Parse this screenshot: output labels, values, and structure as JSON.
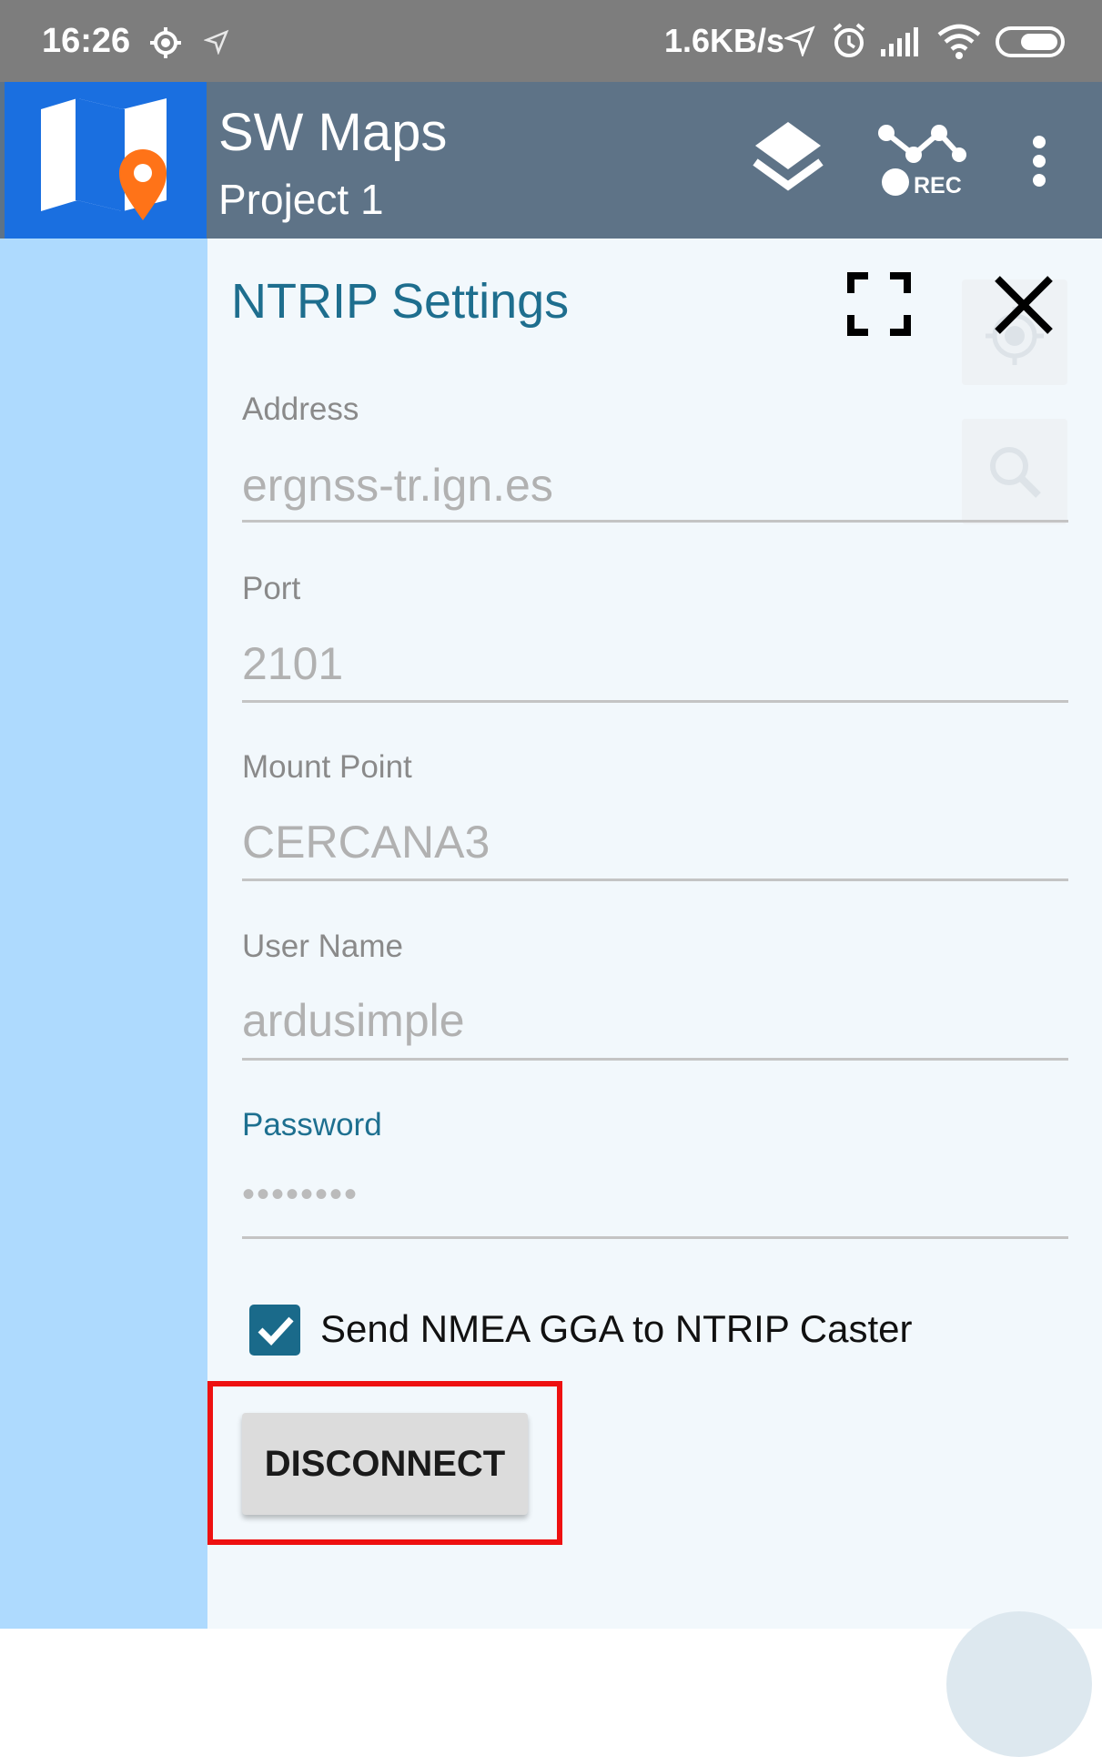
{
  "status_bar": {
    "time": "16:26",
    "network_speed": "1.6KB/s",
    "icons": [
      "location-target-icon",
      "navigation-arrow-icon",
      "navigation-arrow-icon",
      "alarm-icon",
      "cell-signal-icon",
      "wifi-icon",
      "battery-icon"
    ]
  },
  "toolbar": {
    "app_name": "SW Maps",
    "project_name": "Project 1",
    "icons": [
      "map-logo-icon",
      "layers-icon",
      "rec-track-icon",
      "more-vert-icon"
    ],
    "rec_label": "REC"
  },
  "ntrip": {
    "title": "NTRIP Settings",
    "fields": [
      {
        "label": "Address",
        "value": "ergnss-tr.ign.es"
      },
      {
        "label": "Port",
        "value": "2101"
      },
      {
        "label": "Mount Point",
        "value": "CERCANA3"
      },
      {
        "label": "User Name",
        "value": "ardusimple"
      },
      {
        "label": "Password",
        "value": "••••••••"
      }
    ],
    "send_gga_label": "Send NMEA GGA to NTRIP Caster",
    "send_gga_checked": true,
    "disconnect_label": "DISCONNECT"
  },
  "colors": {
    "toolbar": "#5e7387",
    "accent": "#1e6e8e",
    "highlight": "#ee1111",
    "left_strip": "#aedafe"
  }
}
